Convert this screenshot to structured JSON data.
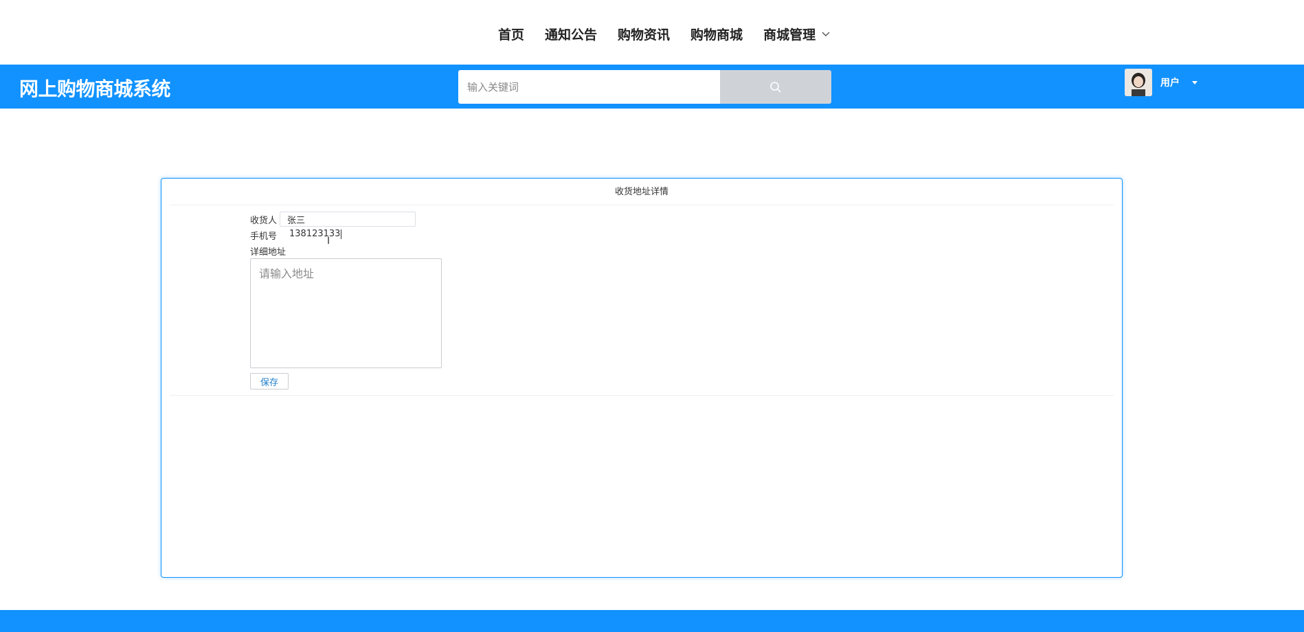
{
  "nav": {
    "items": [
      "首页",
      "通知公告",
      "购物资讯",
      "购物商城",
      "商城管理"
    ]
  },
  "header": {
    "brand": "网上购物商城系统",
    "search_placeholder": "输入关键词",
    "username": "用户",
    "accent_color": "#1192ff"
  },
  "card": {
    "title": "收货地址详情",
    "receiver_label": "收货人",
    "receiver_value": "张三",
    "phone_label": "手机号",
    "phone_value": "138123133",
    "address_label": "详细地址",
    "address_placeholder": "请输入地址",
    "save_label": "保存"
  },
  "icons": {
    "search": "search-icon",
    "dropdown": "chevron-down-icon",
    "caret": "caret-down-icon"
  }
}
